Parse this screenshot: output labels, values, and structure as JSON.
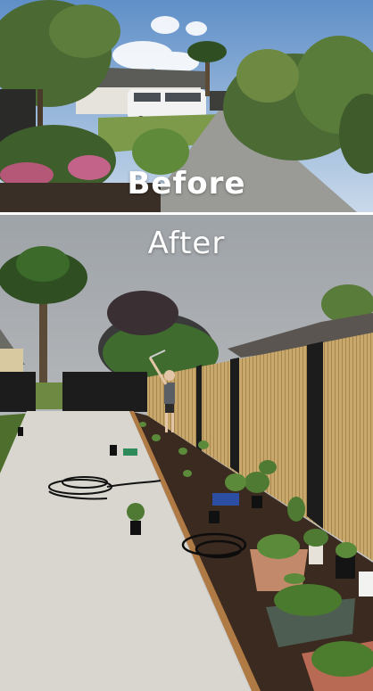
{
  "captions": {
    "before": "Before",
    "after": "After"
  },
  "colors": {
    "sky_before": "#7fa9d6",
    "sky_after": "#b9bcbf",
    "driveway": "#9a9b97",
    "concrete": "#d8d6cf",
    "bamboo_fence": "#c9a96b",
    "black_post": "#1c1c1c",
    "soil": "#3b2a1f",
    "timber_edge": "#b07a45",
    "foliage": "#3f6b2f",
    "palm": "#2f4f22",
    "van": "#f2f2f2"
  }
}
